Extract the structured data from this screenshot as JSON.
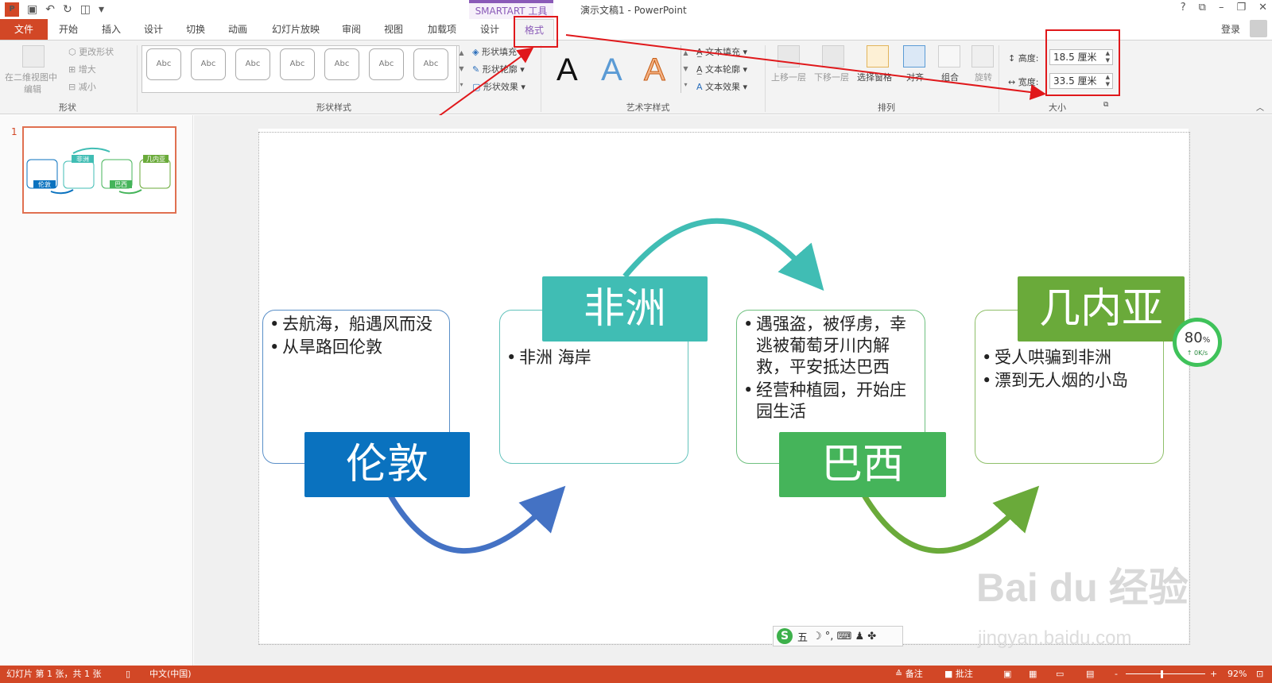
{
  "titlebar": {
    "context_tab": "SMARTART 工具",
    "doc_title": "演示文稿1 - PowerPoint",
    "app_icon": "P",
    "help": "?",
    "restore_ribbon": "⧉",
    "minimize": "–",
    "maximize": "❐",
    "close": "✕"
  },
  "tabs": {
    "file": "文件",
    "home": "开始",
    "insert": "插入",
    "design": "设计",
    "transitions": "切换",
    "animations": "动画",
    "slideshow": "幻灯片放映",
    "review": "审阅",
    "view": "视图",
    "addins": "加载项",
    "sa_design": "设计",
    "sa_format": "格式",
    "login": "登录"
  },
  "ribbon": {
    "edit_2d_line1": "在二维视图中",
    "edit_2d_line2": "编辑",
    "change_shape": "更改形状",
    "larger": "增大",
    "smaller": "减小",
    "group_shapes": "形状",
    "style_thumb": "Abc",
    "shape_fill": "形状填充",
    "shape_outline": "形状轮廓",
    "shape_effect": "形状效果",
    "group_shape_styles": "形状样式",
    "wordart_letter": "A",
    "text_fill": "文本填充",
    "text_outline": "文本轮廓",
    "text_effect": "文本效果",
    "group_wordart": "艺术字样式",
    "bring_forward": "上移一层",
    "send_backward": "下移一层",
    "selection_pane": "选择窗格",
    "align": "对齐",
    "group": "组合",
    "rotate": "旋转",
    "group_arrange": "排列",
    "height_label": "高度:",
    "height_value": "18.5 厘米",
    "width_label": "宽度:",
    "width_value": "33.5 厘米",
    "group_size": "大小"
  },
  "thumbnail": {
    "slide_number": "1",
    "t1": "伦敦",
    "t2": "非洲",
    "t3": "巴西",
    "t4": "几内亚"
  },
  "diagram": {
    "london": {
      "title": "伦敦",
      "bullets": [
        "去航海，船遇风而没",
        "从旱路回伦敦"
      ]
    },
    "africa": {
      "title": "非洲",
      "bullets": [
        "非洲 海岸"
      ]
    },
    "brazil": {
      "title": "巴西",
      "bullets": [
        "遇强盗，被俘虏，幸逃被葡萄牙川内解救，平安抵达巴西",
        "经营种植园，开始庄园生活"
      ]
    },
    "guinea": {
      "title": "几内亚",
      "bullets": [
        "受人哄骗到非洲",
        "漂到无人烟的小岛"
      ]
    }
  },
  "overlay": {
    "speed_pct": "80",
    "speed_unit": "%",
    "speed_rate": "↑ 0K/s",
    "ime_logo": "S",
    "ime_mode": "五",
    "ime_icons": "☽ °, ⌨ ♟ ✤"
  },
  "watermark": {
    "brand": "Bai du 经验",
    "url": "jingyan.baidu.com"
  },
  "statusbar": {
    "slide_info": "幻灯片 第 1 张，共 1 张",
    "language": "中文(中国)",
    "notes": "≙ 备注",
    "comments": "■ 批注",
    "zoom_minus": "-",
    "zoom_plus": "+",
    "zoom": "92%"
  },
  "colors": {
    "accent_ppt": "#d24726",
    "london": "#0a72bf",
    "africa": "#40bdb4",
    "brazil": "#45b45a",
    "guinea": "#6aaa3a",
    "annotation": "#e0181b"
  }
}
